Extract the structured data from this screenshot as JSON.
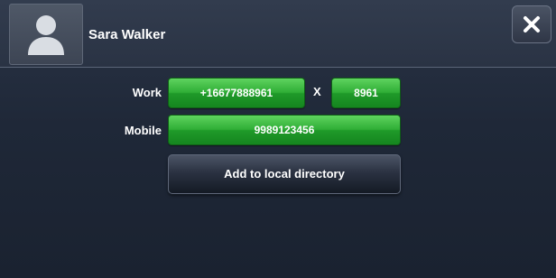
{
  "contact": {
    "name": "Sara Walker",
    "avatar_icon": "person-silhouette-icon"
  },
  "header": {
    "close_icon": "close-icon"
  },
  "numbers": {
    "work_label": "Work",
    "work_number": "+16677888961",
    "extension_separator": "X",
    "work_extension": "8961",
    "mobile_label": "Mobile",
    "mobile_number": "9989123456"
  },
  "actions": {
    "add_to_directory_label": "Add to local directory"
  },
  "colors": {
    "background": "#1e2635",
    "dial_button": "#2fae36",
    "action_button": "#2b3242"
  }
}
